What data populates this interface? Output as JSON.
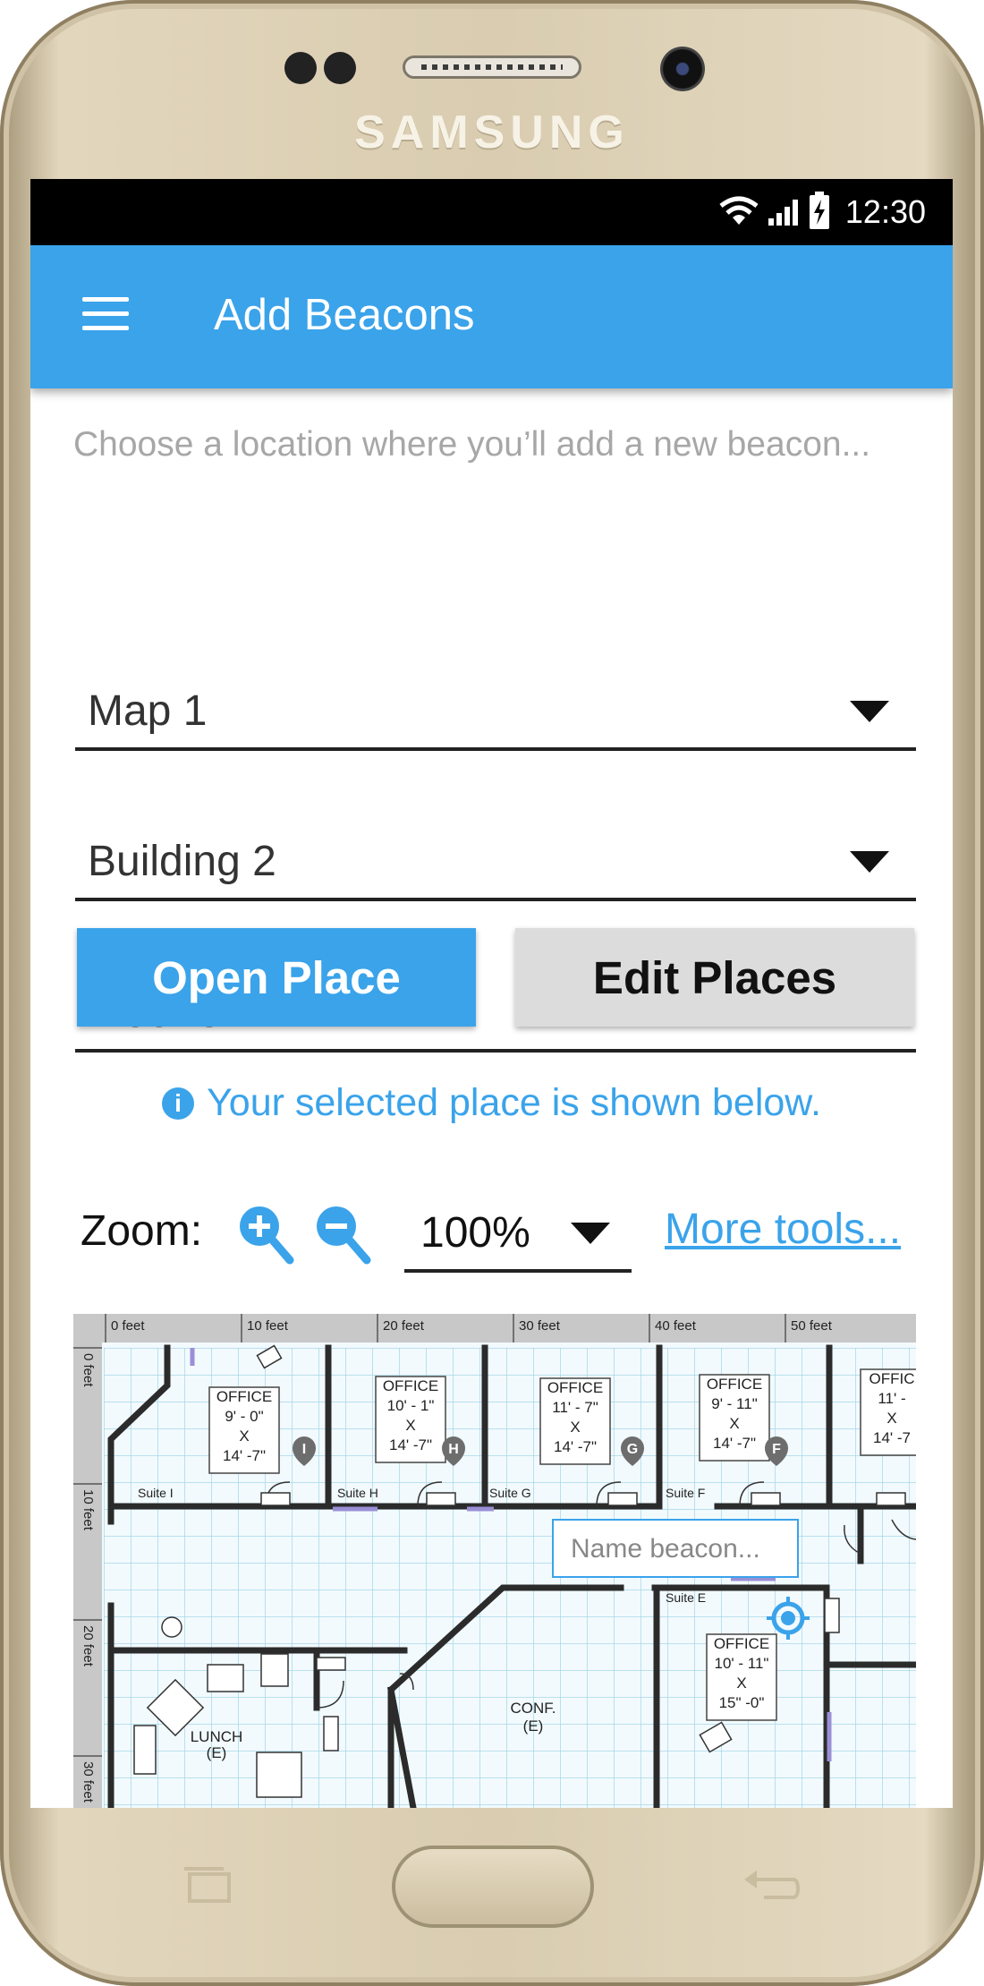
{
  "device": {
    "brand": "SAMSUNG"
  },
  "status_bar": {
    "time": "12:30"
  },
  "app_bar": {
    "title": "Add Beacons"
  },
  "form": {
    "prompt": "Choose a location where you’ll add a new beacon...",
    "map_select": "Map 1",
    "building_select": "Building 2",
    "floor_select": "Floor 3"
  },
  "buttons": {
    "open_place": "Open Place",
    "edit_places": "Edit Places"
  },
  "info": {
    "text": "Your selected place is shown below.",
    "icon": "i"
  },
  "zoom": {
    "label": "Zoom:",
    "level": "100%",
    "more_tools": "More tools..."
  },
  "map": {
    "ruler_x": [
      "0 feet",
      "10 feet",
      "20 feet",
      "30 feet",
      "40 feet",
      "50 feet"
    ],
    "ruler_y": [
      "0 feet",
      "10 feet",
      "20 feet",
      "30 feet"
    ],
    "rooms": [
      {
        "name": "OFFICE",
        "dims": [
          "9' - 0\"",
          "X",
          "14' -7\""
        ]
      },
      {
        "name": "OFFICE",
        "dims": [
          "10' - 1\"",
          "X",
          "14' -7\""
        ]
      },
      {
        "name": "OFFICE",
        "dims": [
          "11' - 7\"",
          "X",
          "14' -7\""
        ]
      },
      {
        "name": "OFFICE",
        "dims": [
          "9' - 11\"",
          "X",
          "14' -7\""
        ]
      },
      {
        "name": "OFFIC",
        "dims": [
          "11' -",
          "X",
          "14' -7"
        ]
      },
      {
        "name": "OFFICE",
        "dims": [
          "10' - 11\"",
          "X",
          "15\" -0\""
        ]
      }
    ],
    "suites": [
      "Suite I",
      "Suite H",
      "Suite G",
      "Suite F",
      "Suite E"
    ],
    "beacons": [
      "I",
      "H",
      "G",
      "F"
    ],
    "labels": {
      "conf": "CONF.",
      "conf_sub": "(E)",
      "lunch": "LUNCH",
      "lunch_sub": "(E)"
    },
    "name_beacon_placeholder": "Name beacon..."
  },
  "colors": {
    "accent": "#3aa3ea",
    "edit_button": "#dcdcdc",
    "hint_text": "#a7a7a7"
  }
}
